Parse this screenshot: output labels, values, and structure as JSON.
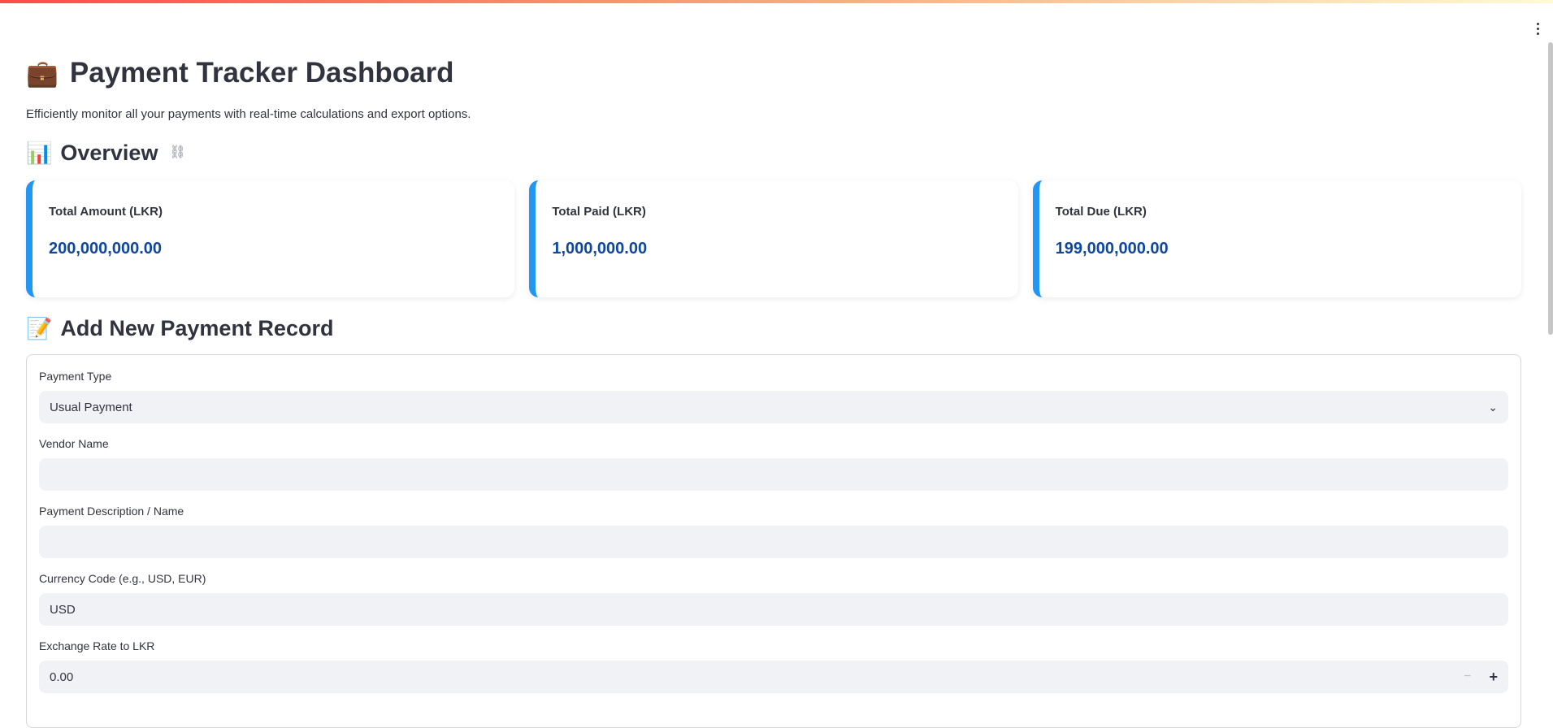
{
  "header": {
    "title": "Payment Tracker Dashboard",
    "title_icon": "💼",
    "subtitle": "Efficiently monitor all your payments with real-time calculations and export options."
  },
  "overview": {
    "heading": "Overview",
    "heading_icon": "📊",
    "cards": [
      {
        "label": "Total Amount (LKR)",
        "value": "200,000,000.00"
      },
      {
        "label": "Total Paid (LKR)",
        "value": "1,000,000.00"
      },
      {
        "label": "Total Due (LKR)",
        "value": "199,000,000.00"
      }
    ]
  },
  "add_record": {
    "heading": "Add New Payment Record",
    "heading_icon": "📝",
    "fields": {
      "payment_type": {
        "label": "Payment Type",
        "value": "Usual Payment"
      },
      "vendor_name": {
        "label": "Vendor Name",
        "value": ""
      },
      "description": {
        "label": "Payment Description / Name",
        "value": ""
      },
      "currency": {
        "label": "Currency Code (e.g., USD, EUR)",
        "value": "USD"
      },
      "exchange_rate": {
        "label": "Exchange Rate to LKR",
        "value": "0.00"
      }
    }
  },
  "colors": {
    "accent": "#2196f3",
    "value_text": "#0d47a1",
    "input_bg": "#f0f2f6"
  }
}
